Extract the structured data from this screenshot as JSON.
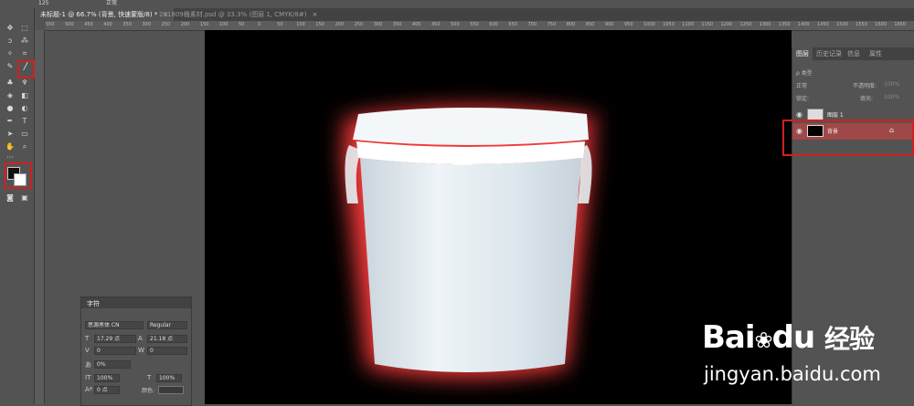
{
  "options_bar": {
    "size": "125",
    "mode": "正常"
  },
  "tabs": [
    {
      "label": "未标题-1 @ 66.7% (背景, 快速蒙版/8) *",
      "close": "×"
    },
    {
      "label": "201809桶素材.psd @ 33.3% (图层 1, CMYK/8#)",
      "close": "×"
    }
  ],
  "ruler_ticks": [
    "550",
    "500",
    "450",
    "400",
    "350",
    "300",
    "250",
    "200",
    "150",
    "100",
    "50",
    "0",
    "50",
    "100",
    "150",
    "200",
    "250",
    "300",
    "350",
    "400",
    "450",
    "500",
    "550",
    "600",
    "650",
    "700",
    "750",
    "800",
    "850",
    "900",
    "950",
    "1000",
    "1050",
    "1100",
    "1150",
    "1200",
    "1250",
    "1300",
    "1350",
    "1400",
    "1450",
    "1500",
    "1550",
    "1600",
    "1650"
  ],
  "layers_panel": {
    "tabs": [
      "图层",
      "历史记录",
      "信息",
      "属性"
    ],
    "filter": "ρ 类型",
    "blend_mode": "正常",
    "opacity_label": "不透明度:",
    "opacity_value": "100%",
    "lock_label": "锁定:",
    "fill_label": "填充:",
    "fill_value": "100%",
    "layers": [
      {
        "name": "图层 1"
      },
      {
        "name": "背景"
      }
    ]
  },
  "character_panel": {
    "title": "字符",
    "font_family": "思源黑体 CN",
    "font_style": "Regular",
    "size": "17.29 点",
    "leading": "21.18 点",
    "kerning": "0",
    "tracking": "0",
    "scale_pct": "0%",
    "vertical_scale": "100%",
    "horizontal_scale": "100%",
    "baseline": "0 点",
    "color_label": "颜色:"
  },
  "watermark": {
    "brand": "Bai",
    "brand2": "du",
    "suffix": "经验",
    "url": "jingyan.baidu.com"
  },
  "colors": {
    "highlight": "#d02020",
    "canvas": "#000000",
    "glow": "#ff3c3c",
    "bucket": "#dfe9ef",
    "selected_layer": "#a04848"
  }
}
